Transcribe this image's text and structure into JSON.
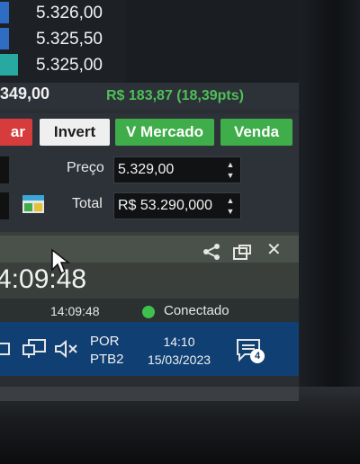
{
  "order_book": {
    "rows": [
      {
        "price": "5.326,00",
        "bar_color": "#2f6cc4",
        "bar_fill": 0.07
      },
      {
        "price": "5.325,50",
        "bar_color": "#2f6cc4",
        "bar_fill": 0.07
      },
      {
        "price": "5.325,00",
        "bar_color": "#27a8a0",
        "bar_fill": 0.14
      }
    ]
  },
  "summary": {
    "left_value": "349,00",
    "right_value": "R$ 183,87 (18,39pts)"
  },
  "buttons": {
    "sell_partial": "ar",
    "invert": "Invert",
    "market": "V Mercado",
    "venda": "Venda"
  },
  "form": {
    "price_label": "Preço",
    "price_value": "5.329,00",
    "total_label": "Total",
    "total_value": "R$ 53.290,000"
  },
  "panel": {
    "big_clock": "4:09:48",
    "small_clock": "14:09:48",
    "status": "Conectado"
  },
  "taskbar": {
    "lang_line1": "POR",
    "lang_line2": "PTB2",
    "time": "14:10",
    "date": "15/03/2023",
    "notification_count": "4"
  },
  "colors": {
    "accent_green": "#3fad4a",
    "sell_red": "#d63c3c",
    "profit_green": "#4fbf59",
    "taskbar_blue": "#0f3f73"
  }
}
